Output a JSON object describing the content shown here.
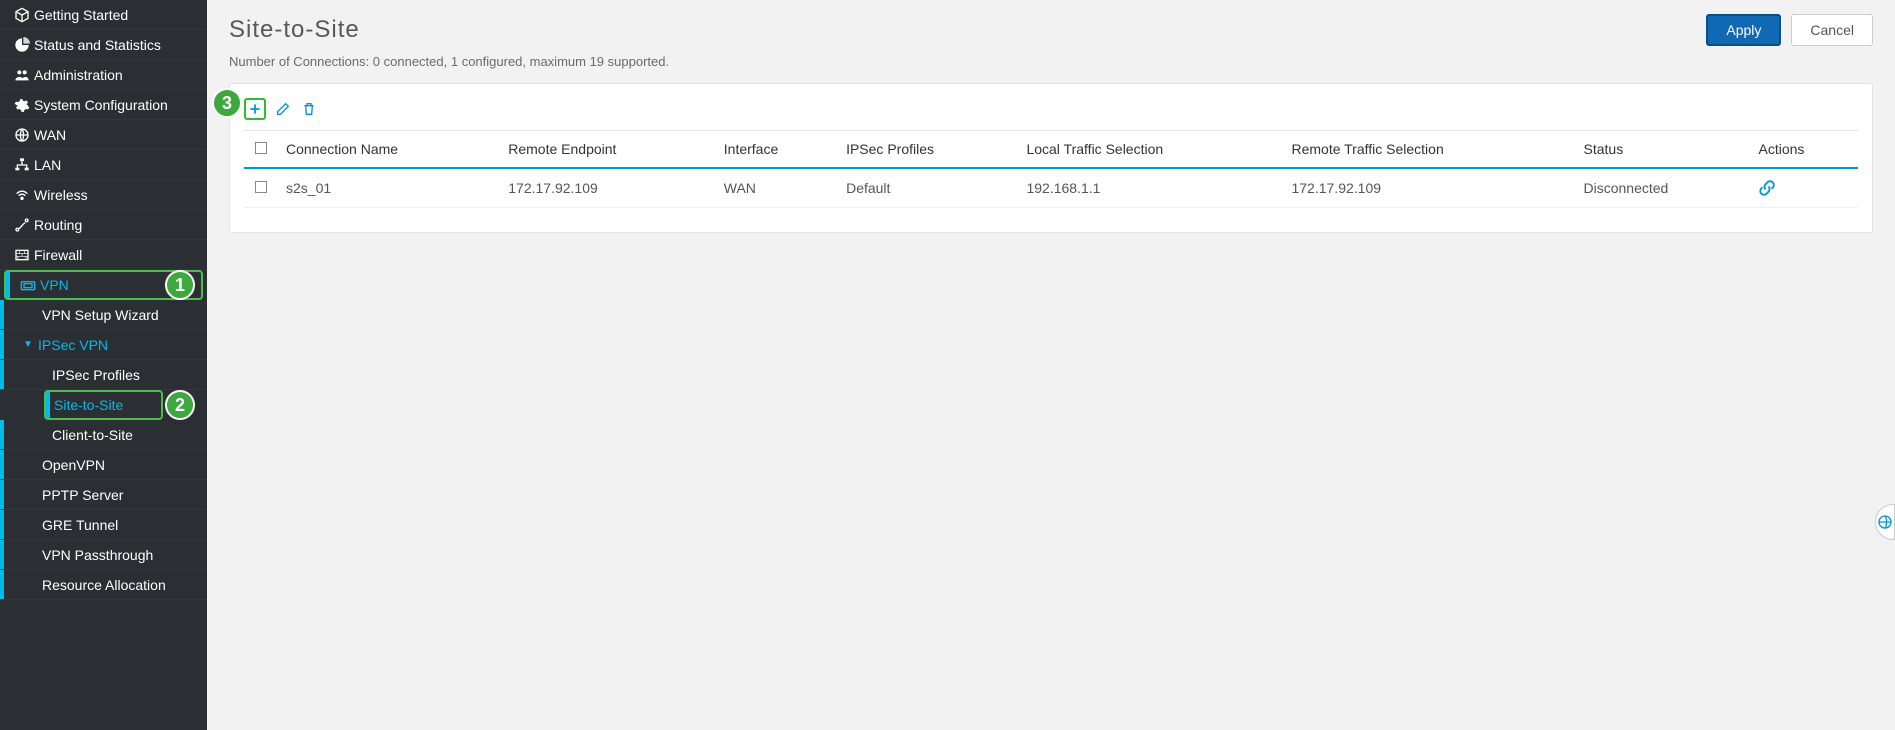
{
  "sidebar": {
    "items": [
      {
        "label": "Getting Started",
        "icon": "cube"
      },
      {
        "label": "Status and Statistics",
        "icon": "chart"
      },
      {
        "label": "Administration",
        "icon": "users"
      },
      {
        "label": "System Configuration",
        "icon": "gear"
      },
      {
        "label": "WAN",
        "icon": "globe"
      },
      {
        "label": "LAN",
        "icon": "lan"
      },
      {
        "label": "Wireless",
        "icon": "wifi"
      },
      {
        "label": "Routing",
        "icon": "routing"
      },
      {
        "label": "Firewall",
        "icon": "firewall"
      }
    ],
    "vpn": {
      "label": "VPN"
    },
    "vpn_children": {
      "wizard": "VPN Setup Wizard",
      "ipsec": "IPSec VPN",
      "ipsec_children": {
        "profiles": "IPSec Profiles",
        "s2s": "Site-to-Site",
        "c2s": "Client-to-Site"
      },
      "openvpn": "OpenVPN",
      "pptp": "PPTP Server",
      "gre": "GRE Tunnel",
      "pass": "VPN Passthrough",
      "res": "Resource Allocation"
    }
  },
  "page": {
    "title": "Site-to-Site",
    "apply": "Apply",
    "cancel": "Cancel",
    "status": "Number of Connections: 0 connected, 1 configured, maximum 19 supported."
  },
  "table": {
    "headers": {
      "name": "Connection Name",
      "remote": "Remote Endpoint",
      "iface": "Interface",
      "prof": "IPSec Profiles",
      "local": "Local Traffic Selection",
      "rts": "Remote Traffic Selection",
      "status": "Status",
      "actions": "Actions"
    },
    "rows": [
      {
        "name": "s2s_01",
        "remote": "172.17.92.109",
        "iface": "WAN",
        "prof": "Default",
        "local": "192.168.1.1",
        "rts": "172.17.92.109",
        "status": "Disconnected"
      }
    ]
  },
  "steps": {
    "one": "1",
    "two": "2",
    "three": "3"
  }
}
